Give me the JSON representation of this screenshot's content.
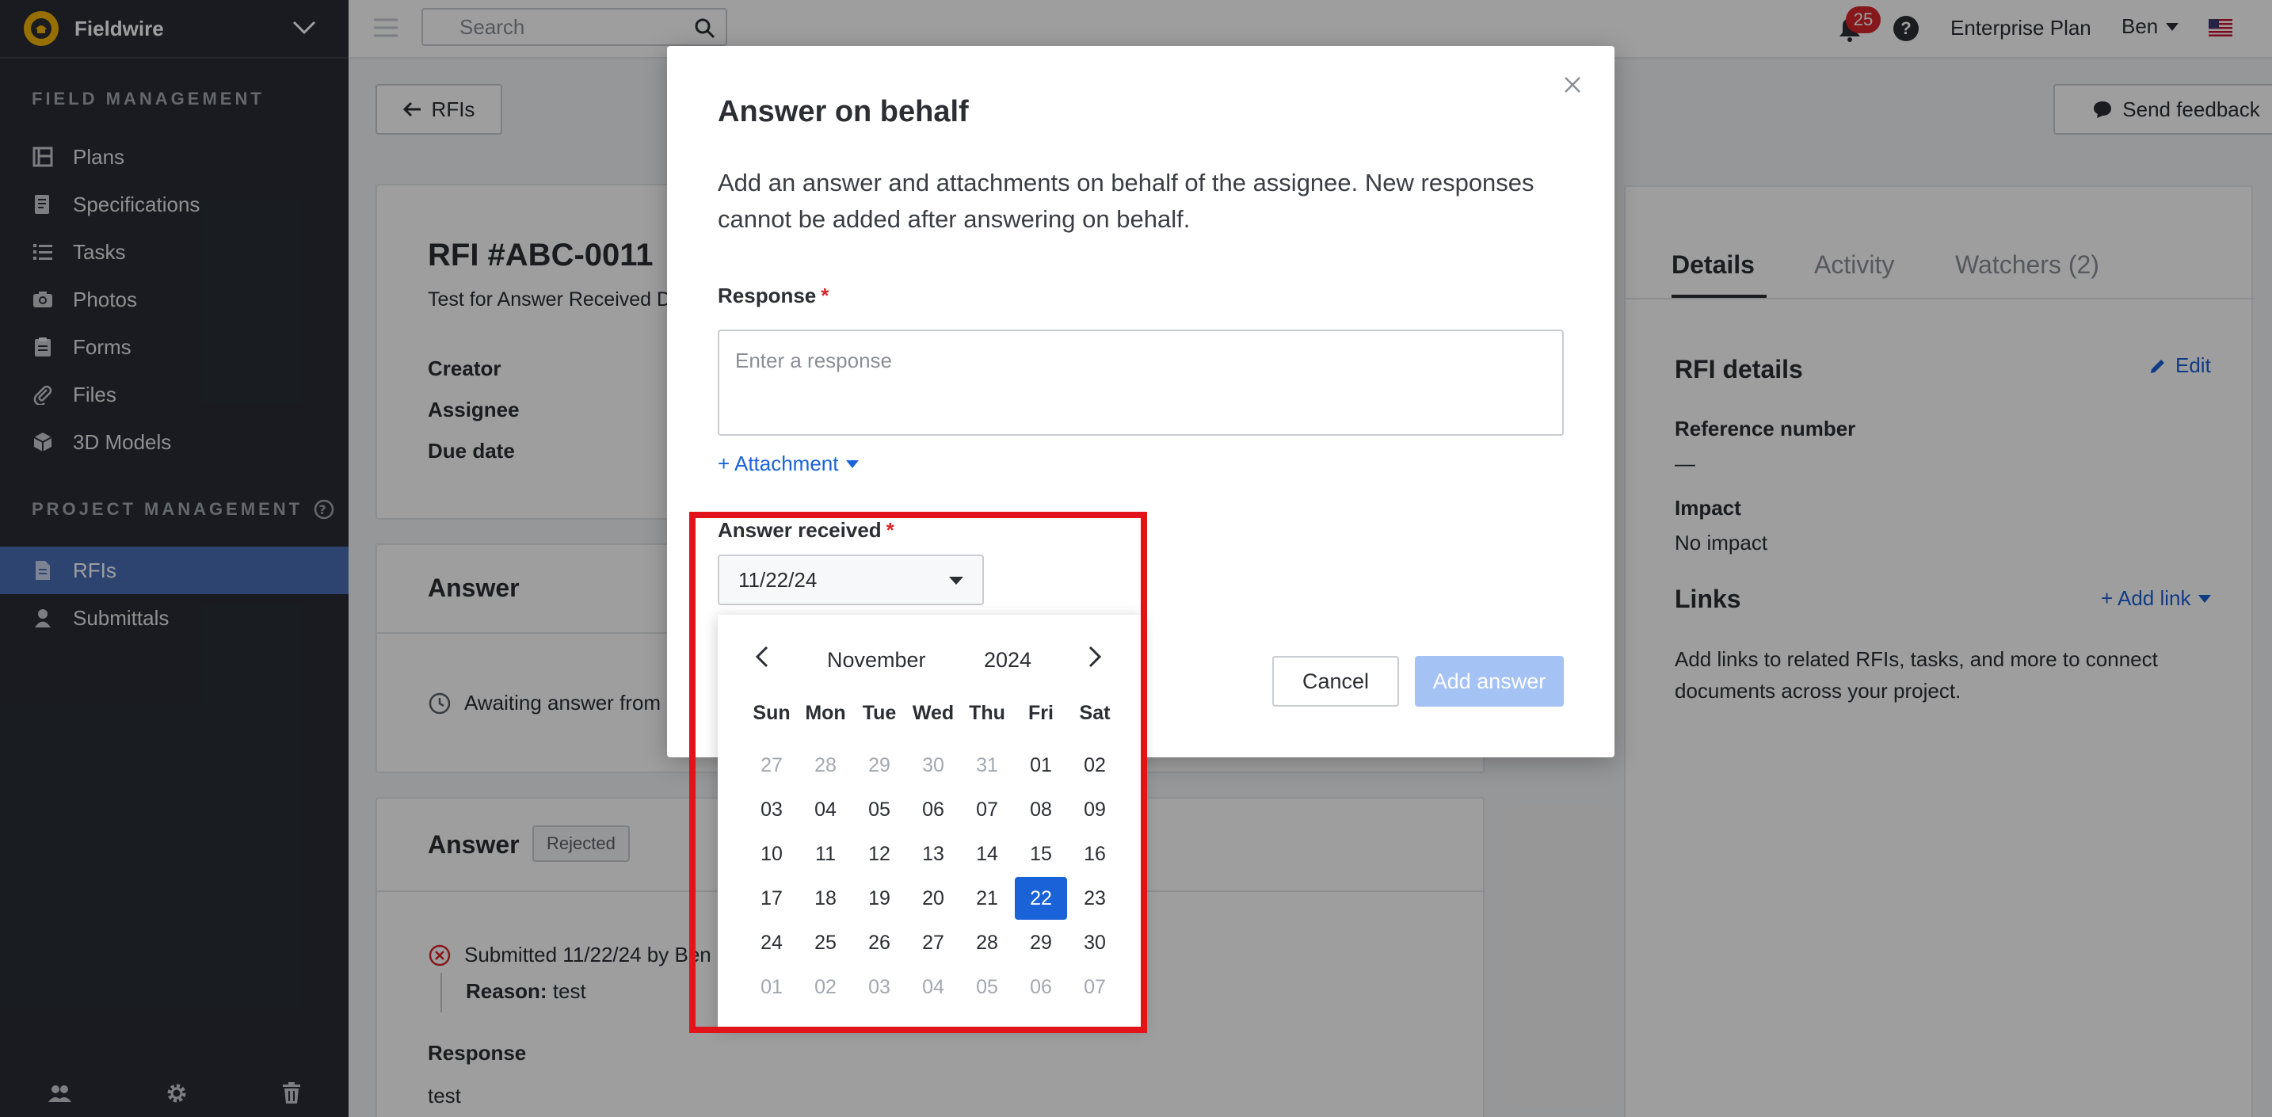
{
  "app": {
    "name": "Fieldwire"
  },
  "sidebar": {
    "field_management_label": "FIELD MANAGEMENT",
    "field_items": [
      {
        "label": "Plans",
        "icon": "plans-icon"
      },
      {
        "label": "Specifications",
        "icon": "specifications-icon"
      },
      {
        "label": "Tasks",
        "icon": "tasks-icon"
      },
      {
        "label": "Photos",
        "icon": "camera-icon"
      },
      {
        "label": "Forms",
        "icon": "clipboard-icon"
      },
      {
        "label": "Files",
        "icon": "paperclip-icon"
      },
      {
        "label": "3D Models",
        "icon": "cube-icon"
      }
    ],
    "project_management_label": "PROJECT MANAGEMENT",
    "project_items": [
      {
        "label": "RFIs",
        "icon": "rfi-icon",
        "active": true
      },
      {
        "label": "Submittals",
        "icon": "submittal-icon"
      }
    ]
  },
  "topbar": {
    "search_placeholder": "Search",
    "notification_count": "25",
    "plan": "Enterprise Plan",
    "user": "Ben"
  },
  "main": {
    "back_label": "RFIs",
    "feedback_label": "Send feedback",
    "rfi": {
      "title": "RFI #ABC-0011",
      "subtitle": "Test for Answer Received D",
      "meta_labels": [
        "Creator",
        "Assignee",
        "Due date"
      ]
    },
    "answer_card": {
      "heading": "Answer",
      "status": "Awaiting answer from"
    },
    "answer_card2": {
      "heading": "Answer",
      "badge": "Rejected",
      "submitted": "Submitted 11/22/24 by Ben",
      "reason_label": "Reason:",
      "reason_value": "test",
      "response_label": "Response",
      "response_value": "test"
    }
  },
  "right_panel": {
    "tabs": [
      "Details",
      "Activity",
      "Watchers (2)"
    ],
    "details_heading": "RFI details",
    "edit_label": "Edit",
    "reference_label": "Reference number",
    "reference_value": "—",
    "impact_label": "Impact",
    "impact_value": "No impact",
    "links_heading": "Links",
    "add_link_label": "+ Add link",
    "links_desc": "Add links to related RFIs, tasks, and more to connect documents across your project."
  },
  "modal": {
    "title": "Answer on behalf",
    "description": "Add an answer and attachments on behalf of the assignee. New responses cannot be added after answering on behalf.",
    "response_label": "Response",
    "required_mark": "*",
    "response_placeholder": "Enter a response",
    "attachment_label": "+ Attachment",
    "answer_received_label": "Answer received",
    "date_value": "11/22/24",
    "cancel_label": "Cancel",
    "add_answer_label": "Add answer"
  },
  "calendar": {
    "month": "November",
    "year": "2024",
    "weekdays": [
      "Sun",
      "Mon",
      "Tue",
      "Wed",
      "Thu",
      "Fri",
      "Sat"
    ],
    "weeks": [
      [
        "27",
        "28",
        "29",
        "30",
        "31",
        "01",
        "02"
      ],
      [
        "03",
        "04",
        "05",
        "06",
        "07",
        "08",
        "09"
      ],
      [
        "10",
        "11",
        "12",
        "13",
        "14",
        "15",
        "16"
      ],
      [
        "17",
        "18",
        "19",
        "20",
        "21",
        "22",
        "23"
      ],
      [
        "24",
        "25",
        "26",
        "27",
        "28",
        "29",
        "30"
      ],
      [
        "01",
        "02",
        "03",
        "04",
        "05",
        "06",
        "07"
      ]
    ],
    "selected": "22",
    "muted_first_week_count": 5,
    "muted_last_week_all": true
  },
  "colors": {
    "sidebar_bg": "#292d34",
    "active_item": "#4a6fb5",
    "link": "#1a62d8",
    "selected_day": "#1a62d8",
    "highlight_box": "#e1141b",
    "add_answer_disabled": "#a4c2f4"
  }
}
